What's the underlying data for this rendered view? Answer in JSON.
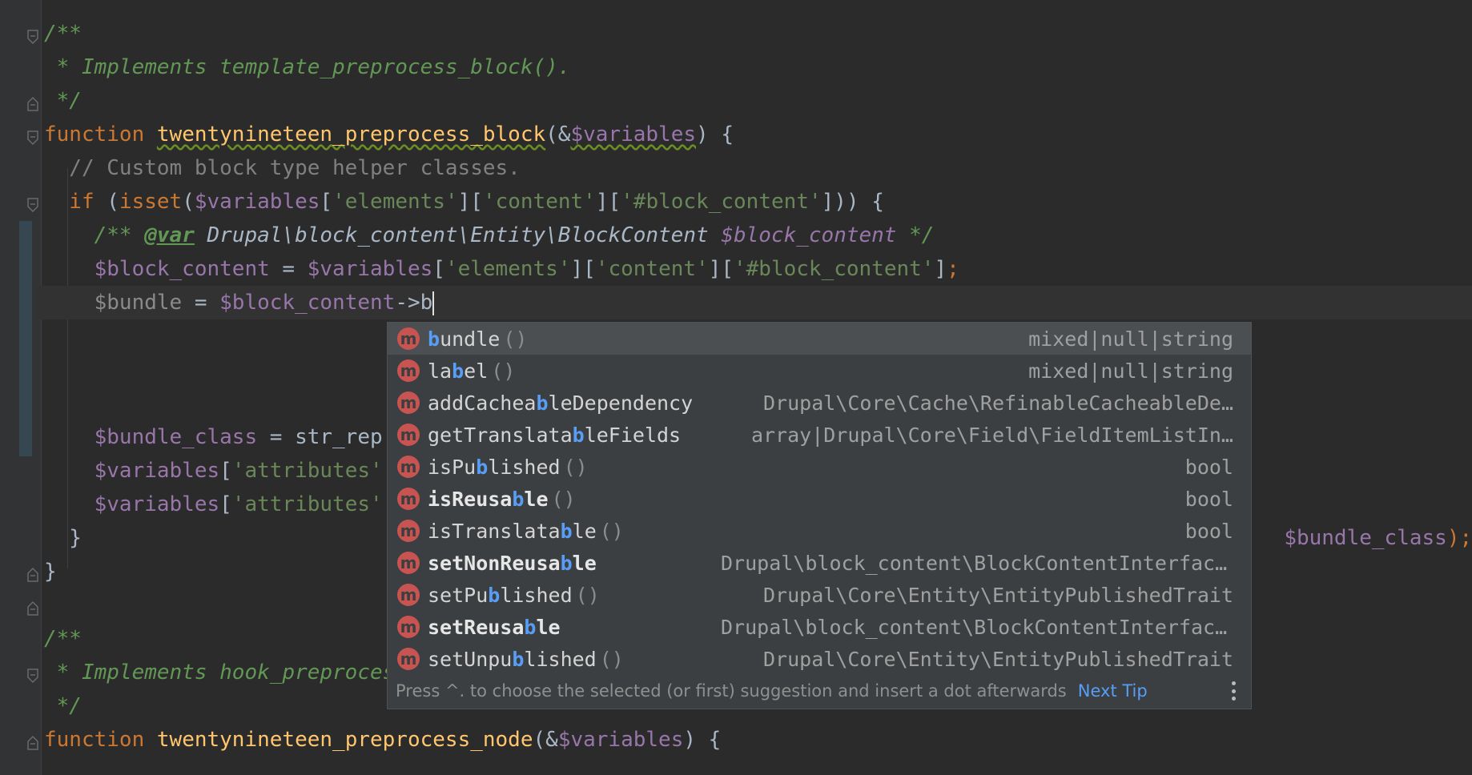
{
  "editor": {
    "lines": [
      {
        "id": 1,
        "segments": [
          {
            "c": "doc",
            "t": "/**"
          }
        ]
      },
      {
        "id": 2,
        "segments": [
          {
            "c": "doc",
            "t": " * Implements template_preprocess_block()."
          }
        ]
      },
      {
        "id": 3,
        "segments": [
          {
            "c": "doc",
            "t": " */"
          }
        ]
      },
      {
        "id": 4,
        "segments": [
          {
            "c": "kw",
            "t": "function "
          },
          {
            "c": "fn squiggle",
            "t": "twentynineteen_preprocess_block"
          },
          {
            "c": "",
            "t": "(&"
          },
          {
            "c": "var squiggle",
            "t": "$variables"
          },
          {
            "c": "",
            "t": ") {"
          }
        ]
      },
      {
        "id": 5,
        "segments": [
          {
            "c": "cmt",
            "t": "  // Custom block type helper classes."
          }
        ]
      },
      {
        "id": 6,
        "segments": [
          {
            "c": "kw",
            "t": "  if "
          },
          {
            "c": "",
            "t": "("
          },
          {
            "c": "kw",
            "t": "isset"
          },
          {
            "c": "",
            "t": "("
          },
          {
            "c": "var",
            "t": "$variables"
          },
          {
            "c": "",
            "t": "["
          },
          {
            "c": "str",
            "t": "'elements'"
          },
          {
            "c": "",
            "t": "]["
          },
          {
            "c": "str",
            "t": "'content'"
          },
          {
            "c": "",
            "t": "]["
          },
          {
            "c": "str",
            "t": "'#block_content'"
          },
          {
            "c": "",
            "t": "])) {"
          }
        ]
      },
      {
        "id": 7,
        "segments": [
          {
            "c": "doc",
            "t": "    /** "
          },
          {
            "c": "doc-tag",
            "t": "@var"
          },
          {
            "c": "doc-type",
            "t": " Drupal\\block_content\\Entity\\BlockContent "
          },
          {
            "c": "doc-var",
            "t": "$block_content"
          },
          {
            "c": "doc",
            "t": " */"
          }
        ]
      },
      {
        "id": 8,
        "segments": [
          {
            "c": "var",
            "t": "    $block_content"
          },
          {
            "c": "",
            "t": " = "
          },
          {
            "c": "var",
            "t": "$variables"
          },
          {
            "c": "",
            "t": "["
          },
          {
            "c": "str",
            "t": "'elements'"
          },
          {
            "c": "",
            "t": "]["
          },
          {
            "c": "str",
            "t": "'content'"
          },
          {
            "c": "",
            "t": "]["
          },
          {
            "c": "str",
            "t": "'#block_content'"
          },
          {
            "c": "",
            "t": "]"
          },
          {
            "c": "kw",
            "t": ";"
          }
        ]
      },
      {
        "id": 9,
        "segments": [
          {
            "c": "faded",
            "t": "    $bundle"
          },
          {
            "c": "",
            "t": " = "
          },
          {
            "c": "var",
            "t": "$block_content"
          },
          {
            "c": "",
            "t": "->b"
          }
        ],
        "current": true
      },
      {
        "id": 10,
        "segments": []
      },
      {
        "id": 11,
        "segments": []
      },
      {
        "id": 12,
        "segments": []
      },
      {
        "id": 13,
        "segments": [
          {
            "c": "var",
            "t": "    $bundle_class"
          },
          {
            "c": "",
            "t": " = str_rep"
          }
        ]
      },
      {
        "id": 14,
        "segments": [
          {
            "c": "var",
            "t": "    $variables"
          },
          {
            "c": "",
            "t": "["
          },
          {
            "c": "str",
            "t": "'attributes'"
          }
        ]
      },
      {
        "id": 15,
        "segments": [
          {
            "c": "var",
            "t": "    $variables"
          },
          {
            "c": "",
            "t": "["
          },
          {
            "c": "str",
            "t": "'attributes'"
          }
        ]
      },
      {
        "id": 16,
        "segments": [
          {
            "c": "",
            "t": "  }"
          }
        ]
      },
      {
        "id": 17,
        "segments": [
          {
            "c": "",
            "t": "}"
          }
        ]
      },
      {
        "id": 18,
        "segments": []
      },
      {
        "id": 19,
        "segments": [
          {
            "c": "doc",
            "t": "/**"
          }
        ]
      },
      {
        "id": 20,
        "segments": [
          {
            "c": "doc",
            "t": " * Implements hook_preprocess_node()."
          }
        ]
      },
      {
        "id": 21,
        "segments": [
          {
            "c": "doc",
            "t": " */"
          }
        ]
      },
      {
        "id": 22,
        "segments": [
          {
            "c": "kw",
            "t": "function "
          },
          {
            "c": "fn",
            "t": "twentynineteen_preprocess_node"
          },
          {
            "c": "",
            "t": "(&"
          },
          {
            "c": "var",
            "t": "$variables"
          },
          {
            "c": "",
            "t": ") {"
          }
        ]
      }
    ],
    "line14_tail": {
      "var": "$bundle_class",
      "end": ");"
    }
  },
  "completion": {
    "items": [
      {
        "prefix": "",
        "match": "b",
        "suffix": "undle",
        "parens": "()",
        "type": "mixed|null|string",
        "bold": false,
        "selected": true
      },
      {
        "prefix": "la",
        "match": "b",
        "suffix": "el",
        "parens": "()",
        "type": "mixed|null|string",
        "bold": false,
        "selected": false
      },
      {
        "prefix": "addCacheab",
        "match": "",
        "suffix": "leDependency",
        "parens": "",
        "type": "Drupal\\Core\\Cache\\RefinableCacheableDe…",
        "bold": false,
        "selected": false,
        "mid": "b",
        "pre2": "addCachea"
      },
      {
        "prefix": "getTranslata",
        "match": "b",
        "suffix": "leFields",
        "parens": "",
        "type": "array|Drupal\\Core\\Field\\FieldItemListIn…",
        "bold": false,
        "selected": false
      },
      {
        "prefix": "isPu",
        "match": "b",
        "suffix": "lished",
        "parens": "()",
        "type": "bool",
        "bold": false,
        "selected": false
      },
      {
        "prefix": "isReusa",
        "match": "b",
        "suffix": "le",
        "parens": "()",
        "type": "bool",
        "bold": true,
        "selected": false
      },
      {
        "prefix": "isTranslata",
        "match": "b",
        "suffix": "le",
        "parens": "()",
        "type": "bool",
        "bold": false,
        "selected": false
      },
      {
        "prefix": "setNonReusa",
        "match": "b",
        "suffix": "le",
        "parens": "",
        "type": "Drupal\\block_content\\BlockContentInterface|Drup…",
        "bold": true,
        "selected": false
      },
      {
        "prefix": "setPu",
        "match": "b",
        "suffix": "lished",
        "parens": "()",
        "type": "Drupal\\Core\\Entity\\EntityPublishedTrait",
        "bold": false,
        "selected": false
      },
      {
        "prefix": "setReusa",
        "match": "b",
        "suffix": "le",
        "parens": "",
        "type": "Drupal\\block_content\\BlockContentInterface|Drupal…",
        "bold": true,
        "selected": false
      },
      {
        "prefix": "setUnpu",
        "match": "b",
        "suffix": "lished",
        "parens": "()",
        "type": "Drupal\\Core\\Entity\\EntityPublishedTrait",
        "bold": false,
        "selected": false
      }
    ],
    "icon_letter": "m",
    "hint": "Press ^. to choose the selected (or first) suggestion and insert a dot afterwards",
    "next_tip": "Next Tip"
  },
  "colors": {
    "background": "#2b2b2b",
    "popup": "#3c3f41",
    "selected_row": "#4b4f52",
    "match_highlight": "#589df6",
    "method_icon": "#c75450"
  }
}
